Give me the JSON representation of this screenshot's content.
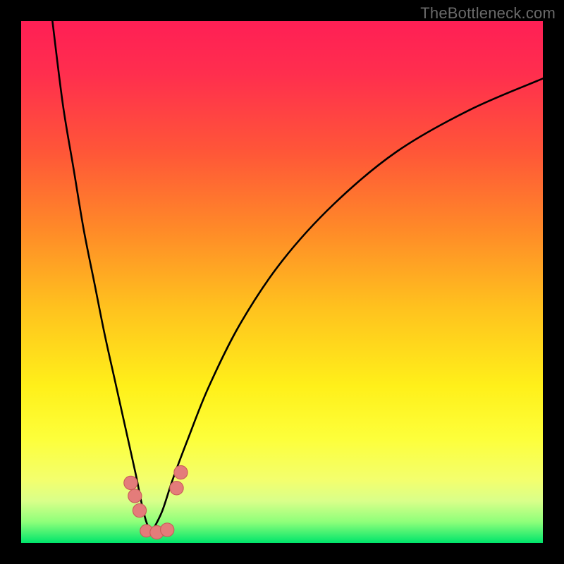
{
  "watermark": "TheBottleneck.com",
  "colors": {
    "frame_bg": "#000000",
    "gradient_stops": [
      {
        "pos": 0.0,
        "color": "#ff1f55"
      },
      {
        "pos": 0.1,
        "color": "#ff2e4e"
      },
      {
        "pos": 0.25,
        "color": "#ff5638"
      },
      {
        "pos": 0.4,
        "color": "#ff8a28"
      },
      {
        "pos": 0.55,
        "color": "#ffc21e"
      },
      {
        "pos": 0.7,
        "color": "#fff01a"
      },
      {
        "pos": 0.8,
        "color": "#fdff3a"
      },
      {
        "pos": 0.88,
        "color": "#f3ff6e"
      },
      {
        "pos": 0.92,
        "color": "#d9ff8a"
      },
      {
        "pos": 0.96,
        "color": "#8eff7a"
      },
      {
        "pos": 1.0,
        "color": "#00e56b"
      }
    ],
    "curve_stroke": "#000000",
    "marker_fill": "#e47c7a",
    "marker_stroke": "#c95c59"
  },
  "chart_data": {
    "type": "line",
    "title": "",
    "xlabel": "",
    "ylabel": "",
    "xlim": [
      0,
      100
    ],
    "ylim": [
      0,
      100
    ],
    "notch_x": 25,
    "series": [
      {
        "name": "left-branch",
        "x": [
          6,
          8,
          10,
          12,
          14,
          16,
          18,
          20,
          22,
          23,
          24,
          25
        ],
        "y": [
          100,
          84,
          72,
          60,
          50,
          40,
          31,
          22,
          13,
          8,
          4,
          2
        ]
      },
      {
        "name": "right-branch",
        "x": [
          25,
          27,
          29,
          32,
          36,
          42,
          50,
          60,
          72,
          86,
          100
        ],
        "y": [
          2,
          6,
          12,
          20,
          30,
          42,
          54,
          65,
          75,
          83,
          89
        ]
      }
    ],
    "markers": [
      {
        "name": "left-cluster-1",
        "x": 21.0,
        "y": 11.5,
        "r": 1.3
      },
      {
        "name": "left-cluster-2",
        "x": 21.8,
        "y": 9.0,
        "r": 1.3
      },
      {
        "name": "left-cluster-3",
        "x": 22.7,
        "y": 6.2,
        "r": 1.3
      },
      {
        "name": "bottom-1",
        "x": 24.0,
        "y": 2.3,
        "r": 1.2
      },
      {
        "name": "bottom-2",
        "x": 26.0,
        "y": 2.0,
        "r": 1.3
      },
      {
        "name": "bottom-3",
        "x": 28.0,
        "y": 2.5,
        "r": 1.3
      },
      {
        "name": "right-cluster-1",
        "x": 29.8,
        "y": 10.5,
        "r": 1.3
      },
      {
        "name": "right-cluster-2",
        "x": 30.6,
        "y": 13.5,
        "r": 1.3
      }
    ]
  }
}
